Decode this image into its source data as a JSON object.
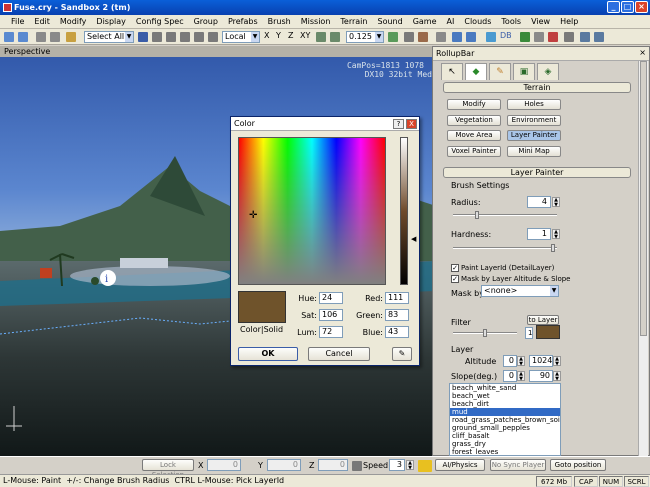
{
  "window": {
    "title": "Fuse.cry - Sandbox 2 (tm)"
  },
  "menu": [
    "File",
    "Edit",
    "Modify",
    "Display",
    "Config Spec",
    "Group",
    "Prefabs",
    "Brush",
    "Mission",
    "Terrain",
    "Sound",
    "Game",
    "AI",
    "Clouds",
    "Tools",
    "View",
    "Help"
  ],
  "toolbar": {
    "select_combo": "Select All",
    "coord_combo": "Local",
    "axes": [
      "X",
      "Y",
      "Z",
      "XY"
    ],
    "snap_value": "0.125",
    "db_label": "DB"
  },
  "viewport": {
    "label": "Perspective",
    "hud_line1": "CamPos=1813 1078",
    "hud_line2": "DX10 32bit Med"
  },
  "color_dialog": {
    "title": "Color",
    "help_btn": "?",
    "close_btn": "X",
    "color_solid_label": "Color|Solid",
    "hue_label": "Hue:",
    "hue": "24",
    "sat_label": "Sat:",
    "sat": "106",
    "lum_label": "Lum:",
    "lum": "72",
    "red_label": "Red:",
    "red": "111",
    "green_label": "Green:",
    "green": "83",
    "blue_label": "Blue:",
    "blue": "43",
    "ok": "OK",
    "cancel": "Cancel",
    "swatch_color": "#6f532b"
  },
  "rollup": {
    "title": "RollupBar",
    "terrain_header": "Terrain",
    "buttons": [
      "Modify",
      "Holes",
      "Vegetation",
      "Environment",
      "Move Area",
      "Layer Painter",
      "Voxel Painter",
      "Mini Map"
    ],
    "layer_painter_header": "Layer Painter",
    "brush_settings": "Brush Settings",
    "radius_label": "Radius:",
    "radius": "4",
    "hardness_label": "Hardness:",
    "hardness": "1",
    "paint_layer_id": "Paint LayerId (DetailLayer)",
    "mask_by_altitude": "Mask by Layer Altitude & Slope",
    "mask_by_label": "Mask by",
    "mask_by_value": "<none>",
    "filter_label": "Filter",
    "to_layer_btn": "to Layer",
    "filter_value": "1",
    "layer_label": "Layer",
    "altitude_label": "Altitude",
    "altitude_min": "0",
    "altitude_max": "1024",
    "slope_label": "Slope(deg.)",
    "slope_min": "0",
    "slope_max": "90",
    "layers": [
      "beach_white_sand",
      "beach_wet",
      "beach_dirt",
      "mud",
      "road_grass_patches_brown_soil",
      "ground_small_pepples",
      "cliff_basalt",
      "grass_dry",
      "forest_leaves"
    ],
    "selected_layer_index": 3
  },
  "bottombar": {
    "lock_selection": "Lock Selection",
    "x_label": "X",
    "x": "0",
    "y_label": "Y",
    "y": "0",
    "z_label": "Z",
    "z": "0",
    "speed_label": "Speed:",
    "speed": "3",
    "ai_physics": "AI/Physics",
    "no_sync": "No Sync Player",
    "goto": "Goto position"
  },
  "statusbar": {
    "text": "L-Mouse: Paint  +/-: Change Brush Radius  CTRL L-Mouse: Pick LayerId",
    "memory": "672 Mb",
    "cap": "CAP",
    "num": "NUM",
    "scrl": "SCRL"
  }
}
